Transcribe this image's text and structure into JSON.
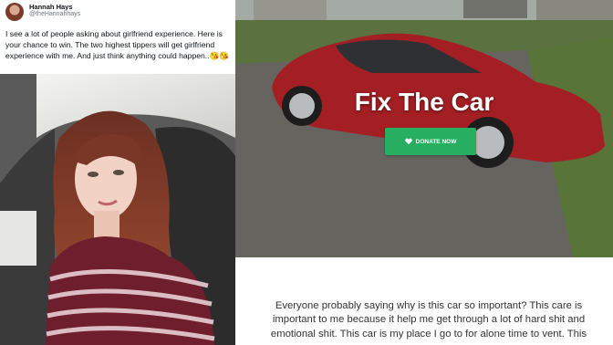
{
  "tweet": {
    "author_name": "Hannah Hays",
    "author_handle": "@theHannahhays",
    "text": "I see a lot of people asking about girlfriend experience. Here is your chance to win. The two highest tippers will get girlfriend experience with me. And just think anything could happen..",
    "emojis": "😘😘"
  },
  "fundraiser": {
    "title": "Fix The Car",
    "donate_label": "DONATE NOW",
    "donate_icon": "heart-icon",
    "story": "Everyone probably saying why is this car so important? This care is important to me because it help me get through a lot of hard shit and emotional shit. This car is my place I go to for alone time to vent. This",
    "accent_color": "#27ae60"
  }
}
